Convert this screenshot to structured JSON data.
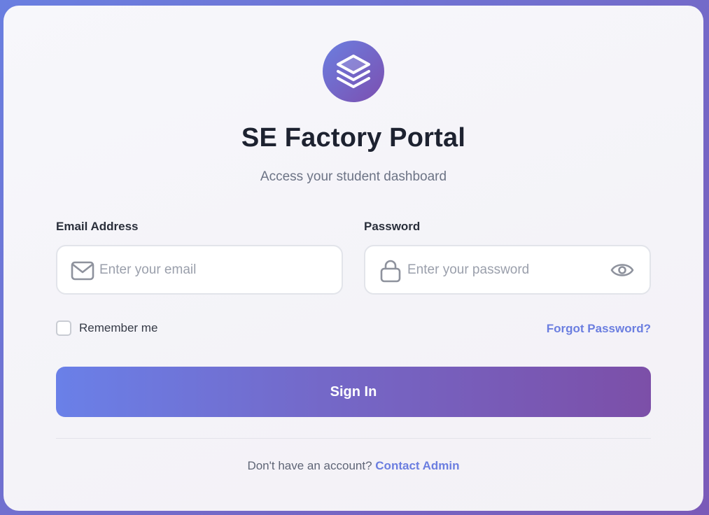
{
  "app": {
    "title": "SE Factory Portal",
    "subtitle": "Access your student dashboard",
    "logo_icon": "stacked-layers-icon"
  },
  "form": {
    "email": {
      "label": "Email Address",
      "placeholder": "Enter your email",
      "value": "",
      "icon": "mail-icon"
    },
    "password": {
      "label": "Password",
      "placeholder": "Enter your password",
      "value": "",
      "icon": "lock-icon",
      "toggle_icon": "eye-icon"
    },
    "remember_label": "Remember me",
    "remember_checked": false,
    "forgot_label": "Forgot Password?",
    "submit_label": "Sign In"
  },
  "footer": {
    "prompt": "Don't have an account?",
    "link_label": "Contact Admin"
  },
  "colors": {
    "accent": "#6b7ee0",
    "gradient_start": "#6a80e8",
    "gradient_end": "#7c4fa8",
    "title": "#1d2230"
  }
}
